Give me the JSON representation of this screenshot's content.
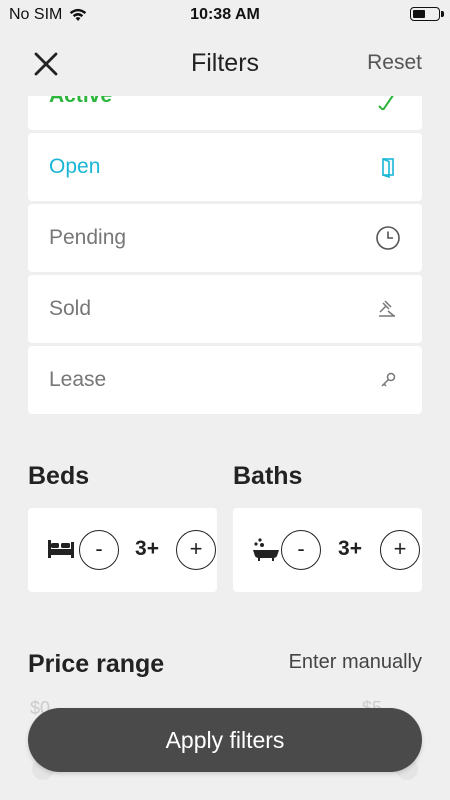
{
  "status_bar": {
    "carrier": "No SIM",
    "time": "10:38 AM",
    "battery_level": 0.5
  },
  "header": {
    "title": "Filters",
    "reset_label": "Reset",
    "close_icon": "close-icon"
  },
  "statuses": [
    {
      "label": "Active",
      "icon": "checkmark-icon",
      "color": "#2db63c"
    },
    {
      "label": "Open",
      "icon": "door-icon",
      "color": "#1ab6d6"
    },
    {
      "label": "Pending",
      "icon": "clock-icon",
      "color": "#777777"
    },
    {
      "label": "Sold",
      "icon": "gavel-icon",
      "color": "#777777"
    },
    {
      "label": "Lease",
      "icon": "key-icon",
      "color": "#777777"
    }
  ],
  "beds": {
    "title": "Beds",
    "minus_label": "-",
    "value": "3+",
    "plus_label": "+",
    "icon": "bed-icon"
  },
  "baths": {
    "title": "Baths",
    "minus_label": "-",
    "value": "3+",
    "plus_label": "+",
    "icon": "bathtub-icon"
  },
  "price": {
    "title": "Price range",
    "enter_manually_label": "Enter manually",
    "min_label": "$0",
    "max_label": "$5"
  },
  "apply_label": "Apply filters",
  "colors": {
    "background": "#efefef",
    "active": "#2db63c",
    "open": "#1ab6d6",
    "muted": "#777777",
    "apply_button": "#4a4a4a"
  }
}
